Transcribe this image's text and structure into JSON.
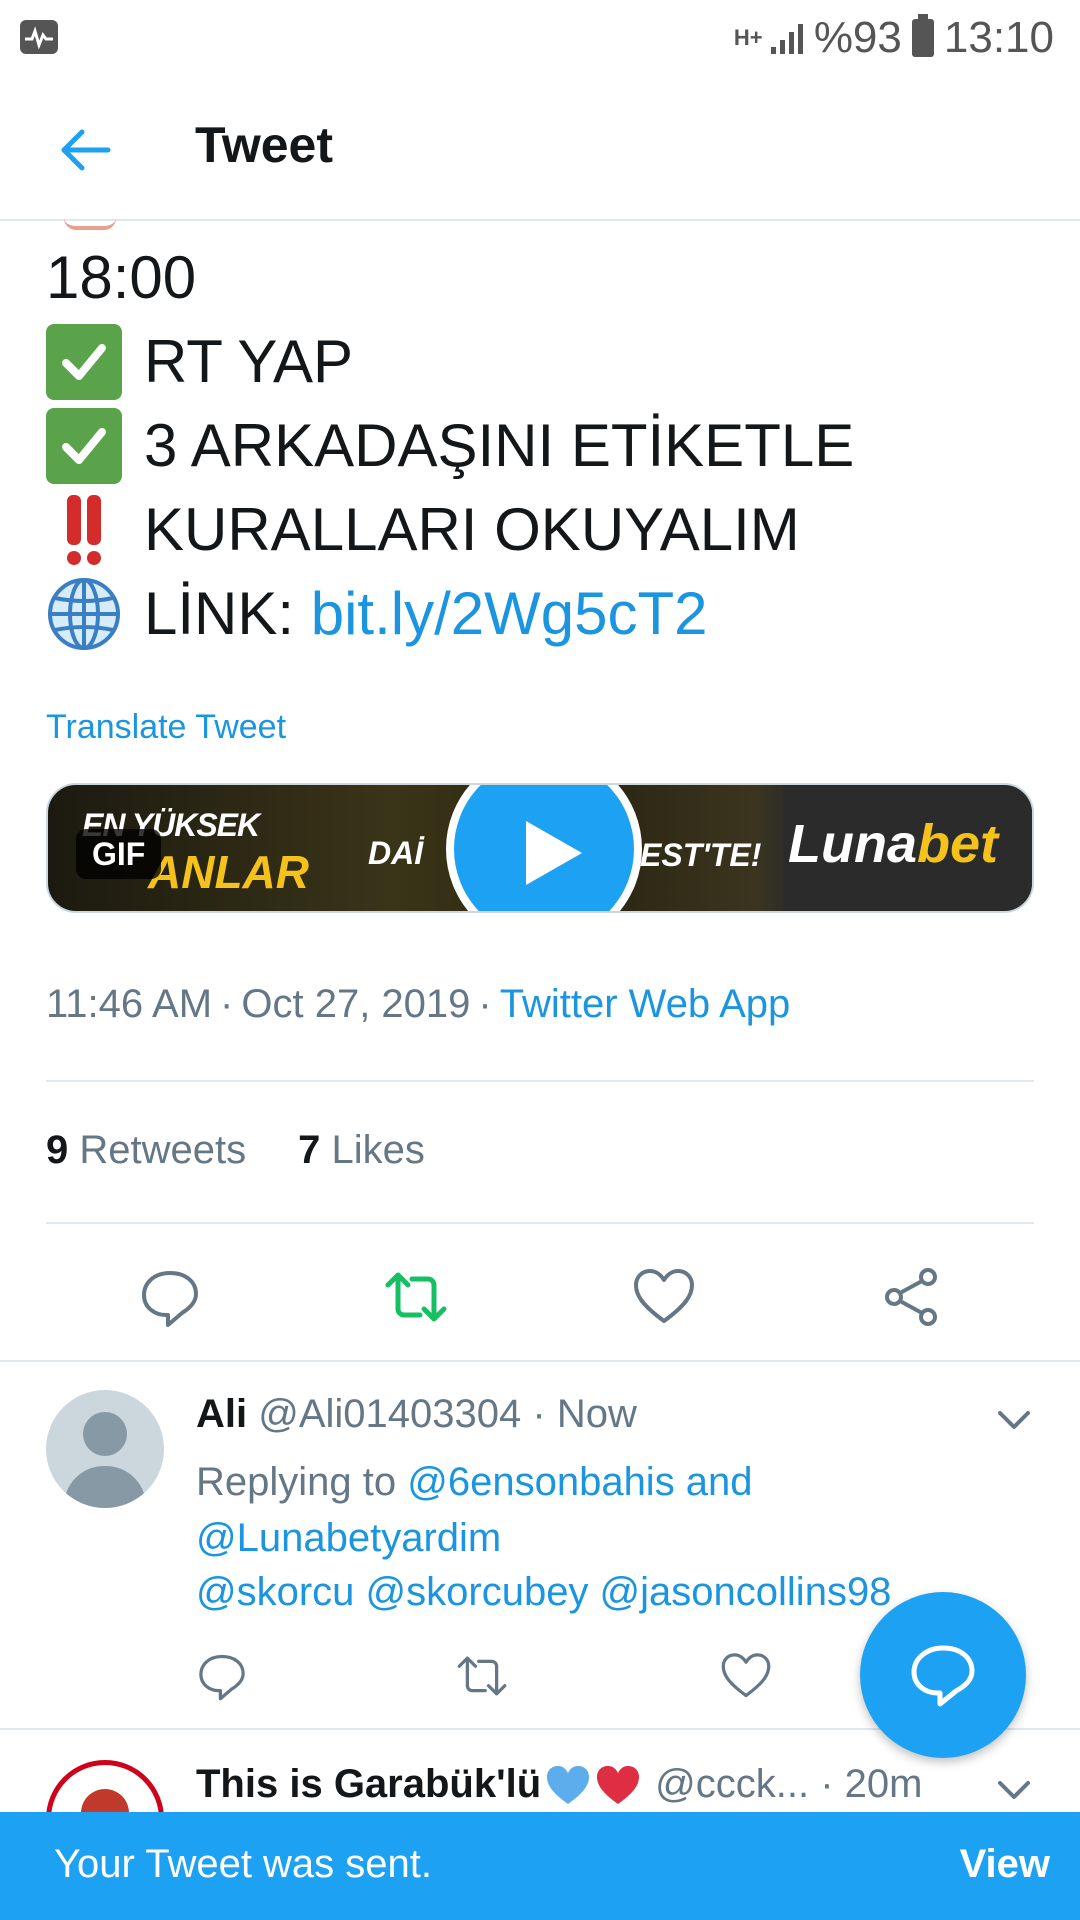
{
  "status_bar": {
    "network": "H+",
    "battery": "%93",
    "time": "13:10"
  },
  "header": {
    "title": "Tweet"
  },
  "tweet": {
    "lines": [
      {
        "emoji": "",
        "text": "18:00"
      },
      {
        "emoji": "check-mark-button-icon",
        "text": "RT YAP"
      },
      {
        "emoji": "check-mark-button-icon",
        "text": "3 ARKADAŞINI ETİKETLE"
      },
      {
        "emoji": "double-exclamation-icon",
        "text": "KURALLARI OKUYALIM"
      },
      {
        "emoji": "globe-icon",
        "text": "LİNK: ",
        "link": "bit.ly/2Wg5cT2"
      }
    ],
    "translate_label": "Translate Tweet",
    "media": {
      "badge": "GIF",
      "text_line1": "EN YÜKSEK",
      "text_line2": "ANLAR",
      "text_mid": "DAİ",
      "text_right": "EST'TE!",
      "brand_part1": "Luna",
      "brand_part2": "bet"
    },
    "time": "11:46 AM",
    "date": "Oct 27, 2019",
    "source": "Twitter Web App",
    "retweets_count": "9",
    "retweets_label": "Retweets",
    "likes_count": "7",
    "likes_label": "Likes"
  },
  "replies": [
    {
      "name": "Ali",
      "handle": "@Ali01403304",
      "time": "Now",
      "replying_prefix": "Replying to ",
      "replying_to": "@6ensonbahis and",
      "replying_to_2": "@Lunabetyardim",
      "text": "@skorcu @skorcubey @jasoncollins98"
    },
    {
      "name": "This is Garabük'lü",
      "handle": "@ccck...",
      "time": "20m"
    }
  ],
  "snackbar": {
    "message": "Your Tweet was sent.",
    "action": "View"
  },
  "colors": {
    "accent": "#1da1f2",
    "link": "#1b95e0",
    "retweet_active": "#17bf63",
    "muted": "#657786"
  }
}
